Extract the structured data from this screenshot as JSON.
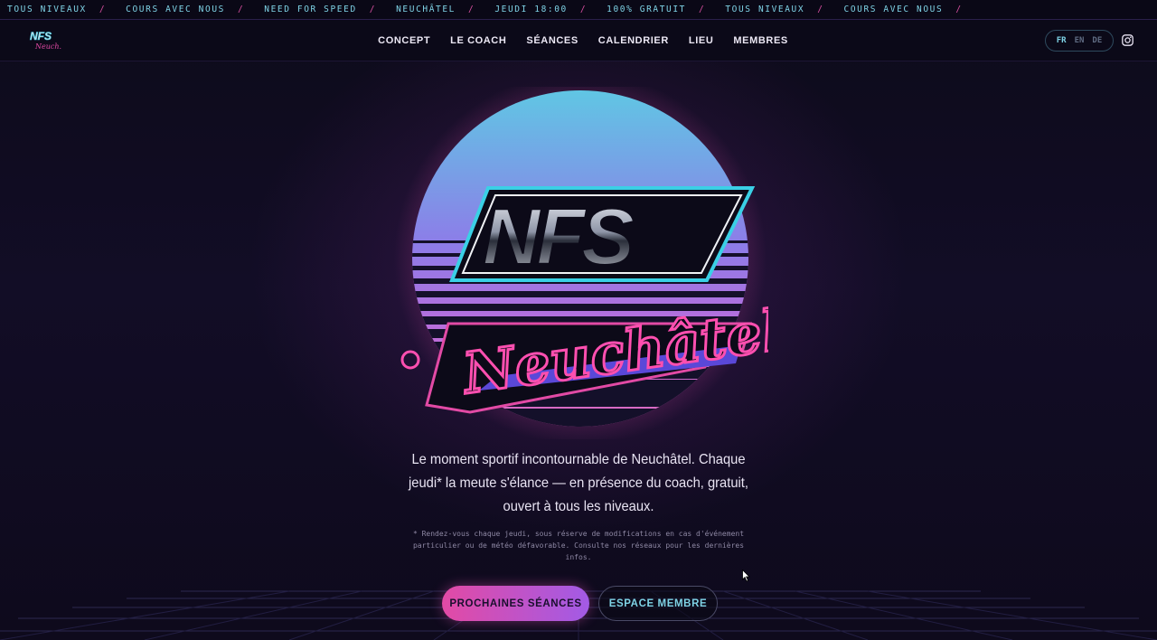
{
  "ticker": {
    "items": [
      "TOUS NIVEAUX",
      "COURS AVEC NOUS",
      "NEED FOR SPEED",
      "NEUCHÂTEL",
      "JEUDI 18:00",
      "100% GRATUIT",
      "TOUS NIVEAUX",
      "COURS AVEC NOUS"
    ],
    "separator": "/"
  },
  "nav": {
    "items": [
      "CONCEPT",
      "LE COACH",
      "SÉANCES",
      "CALENDRIER",
      "LIEU",
      "MEMBRES"
    ]
  },
  "lang": {
    "options": [
      "FR",
      "EN",
      "DE"
    ],
    "active": "FR"
  },
  "hero": {
    "logo_text_top": "NFS",
    "logo_text_bottom": "Neuchâtel",
    "tagline": "Le moment sportif incontournable de Neuchâtel. Chaque jeudi* la meute s'élance — en présence du coach, gratuit, ouvert à tous les niveaux.",
    "footnote": "* Rendez-vous chaque jeudi, sous réserve de modifications en cas d'événement particulier ou de météo défavorable. Consulte nos réseaux pour les dernières infos."
  },
  "buttons": {
    "primary": "PROCHAINES SÉANCES",
    "secondary": "ESPACE MEMBRE"
  },
  "colors": {
    "cyan": "#7fd3e6",
    "pink": "#e24aa5",
    "purple": "#a25be6",
    "background": "#0c0a18"
  },
  "icons": {
    "instagram": "instagram-icon",
    "logo": "nfs-logo"
  }
}
